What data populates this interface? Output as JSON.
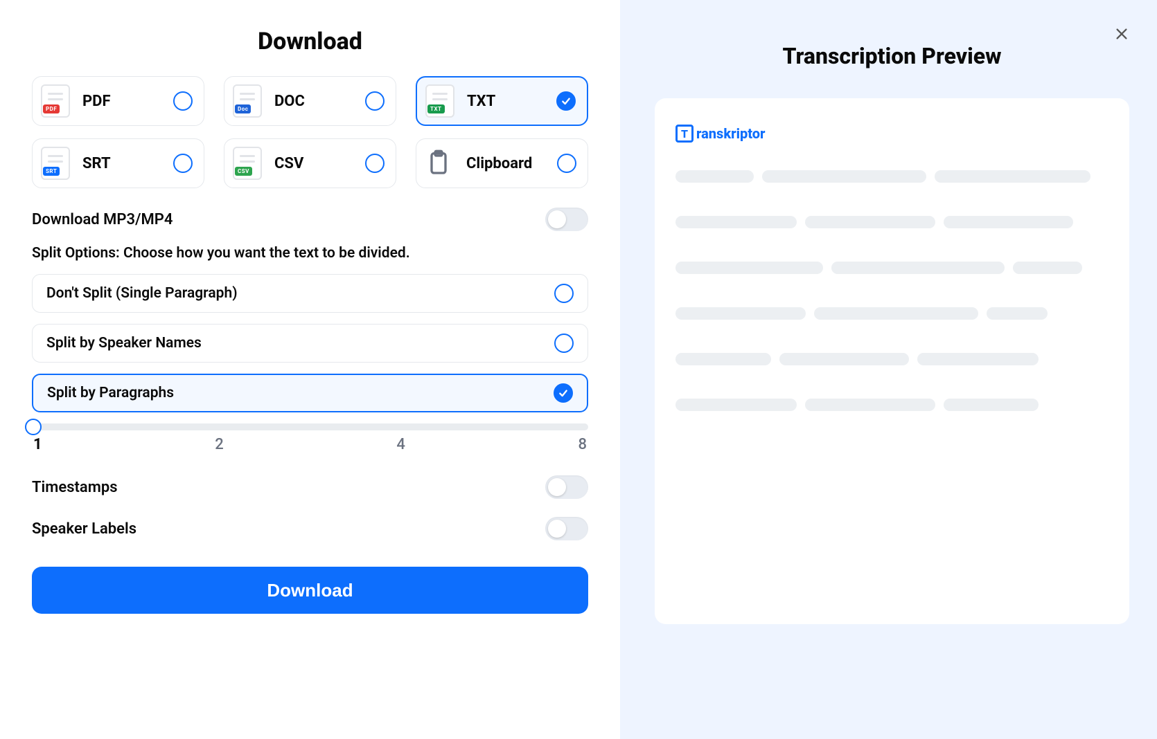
{
  "header": {
    "title": "Download"
  },
  "formats": [
    {
      "label": "PDF",
      "tag": "PDF",
      "tagClass": "tag-pdf",
      "selected": false,
      "name": "format-pdf"
    },
    {
      "label": "DOC",
      "tag": "Doc",
      "tagClass": "tag-doc",
      "selected": false,
      "name": "format-doc"
    },
    {
      "label": "TXT",
      "tag": "TXT",
      "tagClass": "tag-txt",
      "selected": true,
      "name": "format-txt"
    },
    {
      "label": "SRT",
      "tag": "SRT",
      "tagClass": "tag-srt",
      "selected": false,
      "name": "format-srt"
    },
    {
      "label": "CSV",
      "tag": "CSV",
      "tagClass": "tag-csv",
      "selected": false,
      "name": "format-csv"
    },
    {
      "label": "Clipboard",
      "tag": null,
      "tagClass": null,
      "selected": false,
      "name": "format-clipboard",
      "clipboard": true
    }
  ],
  "media_toggle": {
    "label": "Download MP3/MP4",
    "on": false
  },
  "split": {
    "section_label": "Split Options: Choose how you want the text to be divided.",
    "options": [
      {
        "label": "Don't Split (Single Paragraph)",
        "selected": false,
        "name": "split-dont-split"
      },
      {
        "label": "Split by Speaker Names",
        "selected": false,
        "name": "split-by-speaker"
      },
      {
        "label": "Split by Paragraphs",
        "selected": true,
        "name": "split-by-paragraphs"
      }
    ],
    "slider": {
      "value": 1,
      "ticks": [
        "1",
        "2",
        "4",
        "8"
      ]
    }
  },
  "toggles": [
    {
      "label": "Timestamps",
      "on": false,
      "name": "toggle-timestamps"
    },
    {
      "label": "Speaker Labels",
      "on": false,
      "name": "toggle-speaker-labels"
    }
  ],
  "download_button": "Download",
  "preview": {
    "title": "Transcription Preview",
    "brand": "ranskriptor",
    "brand_mark": "T"
  }
}
